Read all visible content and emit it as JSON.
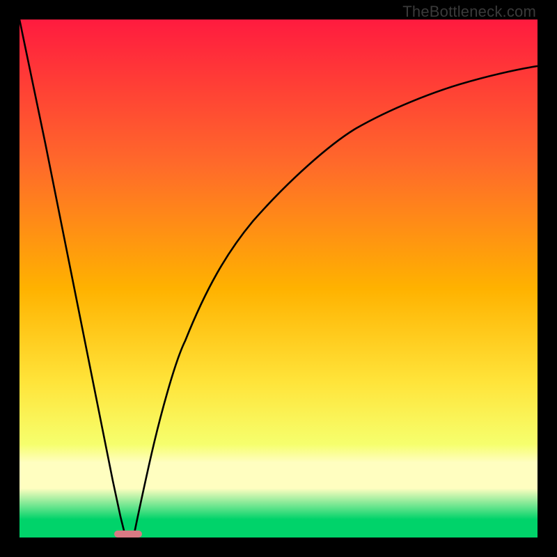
{
  "watermark": "TheBottleneck.com",
  "colors": {
    "frame": "#000000",
    "grad_top": "#ff1b3f",
    "grad_mid1": "#ff6a2a",
    "grad_mid2": "#ffb200",
    "grad_mid3": "#ffe43a",
    "grad_mid4": "#f6ff6d",
    "grad_band": "#fffec0",
    "grad_green": "#00d36a",
    "curve": "#000000",
    "marker": "#d97a84"
  },
  "chart_data": {
    "type": "line",
    "title": "",
    "xlabel": "",
    "ylabel": "",
    "xlim": [
      0,
      100
    ],
    "ylim": [
      0,
      100
    ],
    "series": [
      {
        "name": "left-branch",
        "x": [
          0,
          5,
          10,
          13,
          16,
          18,
          19.5,
          20.5
        ],
        "values": [
          100,
          76,
          51,
          36,
          21,
          11,
          4,
          0
        ]
      },
      {
        "name": "right-branch",
        "x": [
          22,
          23,
          25,
          28,
          32,
          38,
          45,
          55,
          65,
          75,
          85,
          95,
          100
        ],
        "values": [
          0,
          5,
          14,
          26,
          38,
          51,
          61,
          72,
          79,
          84,
          87.5,
          90,
          91
        ]
      }
    ],
    "marker": {
      "x_center": 21,
      "y": 0,
      "width": 5,
      "height": 1.2
    },
    "gradient_stops": [
      {
        "pos": 0.0,
        "color": "#ff1b3f"
      },
      {
        "pos": 0.28,
        "color": "#ff6a2a"
      },
      {
        "pos": 0.52,
        "color": "#ffb200"
      },
      {
        "pos": 0.7,
        "color": "#ffe43a"
      },
      {
        "pos": 0.82,
        "color": "#f6ff6d"
      },
      {
        "pos": 0.855,
        "color": "#fffec0"
      },
      {
        "pos": 0.905,
        "color": "#fffec0"
      },
      {
        "pos": 0.965,
        "color": "#00d36a"
      },
      {
        "pos": 1.0,
        "color": "#00d36a"
      }
    ]
  }
}
